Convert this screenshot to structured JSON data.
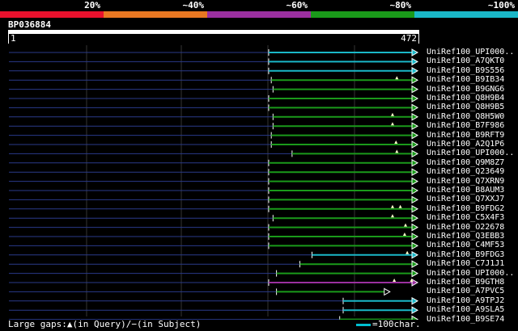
{
  "legend": {
    "labels": [
      "20%",
      "~40%",
      "~60%",
      "~80%",
      "~100%"
    ],
    "colors": [
      "#e8112d",
      "#e87722",
      "#9b30a0",
      "#1a9a1a",
      "#1ab8c8"
    ]
  },
  "query": {
    "id": "BP036884",
    "start": "1",
    "end": "472",
    "length": 472
  },
  "hits": [
    {
      "label": "UniRef100_UPI000..",
      "start": 300,
      "end": 472,
      "color": "#1ab8c8",
      "marks": []
    },
    {
      "label": "UniRef100_A7QKT0",
      "start": 300,
      "end": 472,
      "color": "#1ab8c8",
      "marks": []
    },
    {
      "label": "UniRef100_B9S556",
      "start": 300,
      "end": 472,
      "color": "#1ab8c8",
      "marks": []
    },
    {
      "label": "UniRef100_B9IB34",
      "start": 303,
      "end": 472,
      "color": "#1a9a1a",
      "marks": [
        448
      ]
    },
    {
      "label": "UniRef100_B9GNG6",
      "start": 305,
      "end": 472,
      "color": "#1a9a1a",
      "marks": []
    },
    {
      "label": "UniRef100_Q8H9B4",
      "start": 300,
      "end": 472,
      "color": "#1a9a1a",
      "marks": []
    },
    {
      "label": "UniRef100_Q8H9B5",
      "start": 300,
      "end": 472,
      "color": "#1a9a1a",
      "marks": []
    },
    {
      "label": "UniRef100_Q8H5W0",
      "start": 305,
      "end": 472,
      "color": "#1a9a1a",
      "marks": [
        443
      ]
    },
    {
      "label": "UniRef100_B7F986",
      "start": 305,
      "end": 472,
      "color": "#1a9a1a",
      "marks": [
        443
      ]
    },
    {
      "label": "UniRef100_B9RFT9",
      "start": 303,
      "end": 472,
      "color": "#1a9a1a",
      "marks": []
    },
    {
      "label": "UniRef100_A2Q1P6",
      "start": 303,
      "end": 472,
      "color": "#1a9a1a",
      "marks": [
        447
      ]
    },
    {
      "label": "UniRef100_UPI000..",
      "start": 327,
      "end": 472,
      "color": "#1a9a1a",
      "marks": [
        448
      ]
    },
    {
      "label": "UniRef100_Q9M8Z7",
      "start": 300,
      "end": 472,
      "color": "#1a9a1a",
      "marks": []
    },
    {
      "label": "UniRef100_Q23649",
      "start": 300,
      "end": 472,
      "color": "#1a9a1a",
      "marks": []
    },
    {
      "label": "UniRef100_Q7XRN9",
      "start": 300,
      "end": 472,
      "color": "#1a9a1a",
      "marks": []
    },
    {
      "label": "UniRef100_B8AUM3",
      "start": 300,
      "end": 472,
      "color": "#1a9a1a",
      "marks": []
    },
    {
      "label": "UniRef100_Q7XXJ7",
      "start": 300,
      "end": 472,
      "color": "#1a9a1a",
      "marks": []
    },
    {
      "label": "UniRef100_B9FDG2",
      "start": 300,
      "end": 472,
      "color": "#1a9a1a",
      "marks": [
        443,
        452
      ]
    },
    {
      "label": "UniRef100_C5X4F3",
      "start": 305,
      "end": 472,
      "color": "#1a9a1a",
      "marks": [
        443
      ]
    },
    {
      "label": "UniRef100_O22678",
      "start": 300,
      "end": 472,
      "color": "#1a9a1a",
      "marks": [
        458
      ]
    },
    {
      "label": "UniRef100_Q3EBB3",
      "start": 300,
      "end": 472,
      "color": "#1a9a1a",
      "marks": [
        457
      ]
    },
    {
      "label": "UniRef100_C4MF53",
      "start": 300,
      "end": 472,
      "color": "#1a9a1a",
      "marks": []
    },
    {
      "label": "UniRef100_B9FDG3",
      "start": 350,
      "end": 472,
      "color": "#1ab8c8",
      "marks": [
        460
      ]
    },
    {
      "label": "UniRef100_C7J1J1",
      "start": 336,
      "end": 472,
      "color": "#1a9a1a",
      "marks": []
    },
    {
      "label": "UniRef100_UPI000..",
      "start": 309,
      "end": 472,
      "color": "#1a9a1a",
      "marks": []
    },
    {
      "label": "UniRef100_B9GTH8",
      "start": 300,
      "end": 472,
      "color": "#9b30a0",
      "marks": [
        445,
        465
      ]
    },
    {
      "label": "UniRef100_A7PVC5",
      "start": 309,
      "end": 440,
      "color": "#1a9a1a",
      "marks": [],
      "open_end": true
    },
    {
      "label": "UniRef100_A9TPJ2",
      "start": 386,
      "end": 472,
      "color": "#1ab8c8",
      "marks": []
    },
    {
      "label": "UniRef100_A9SLA5",
      "start": 386,
      "end": 472,
      "color": "#1ab8c8",
      "marks": []
    },
    {
      "label": "UniRef100_B9SE74",
      "start": 382,
      "end": 472,
      "color": "#1a9a1a",
      "marks": []
    }
  ],
  "footer": {
    "gaps_text": "Large gaps:▲(in Query)/−(in Subject)",
    "scale_text": "=100char."
  }
}
